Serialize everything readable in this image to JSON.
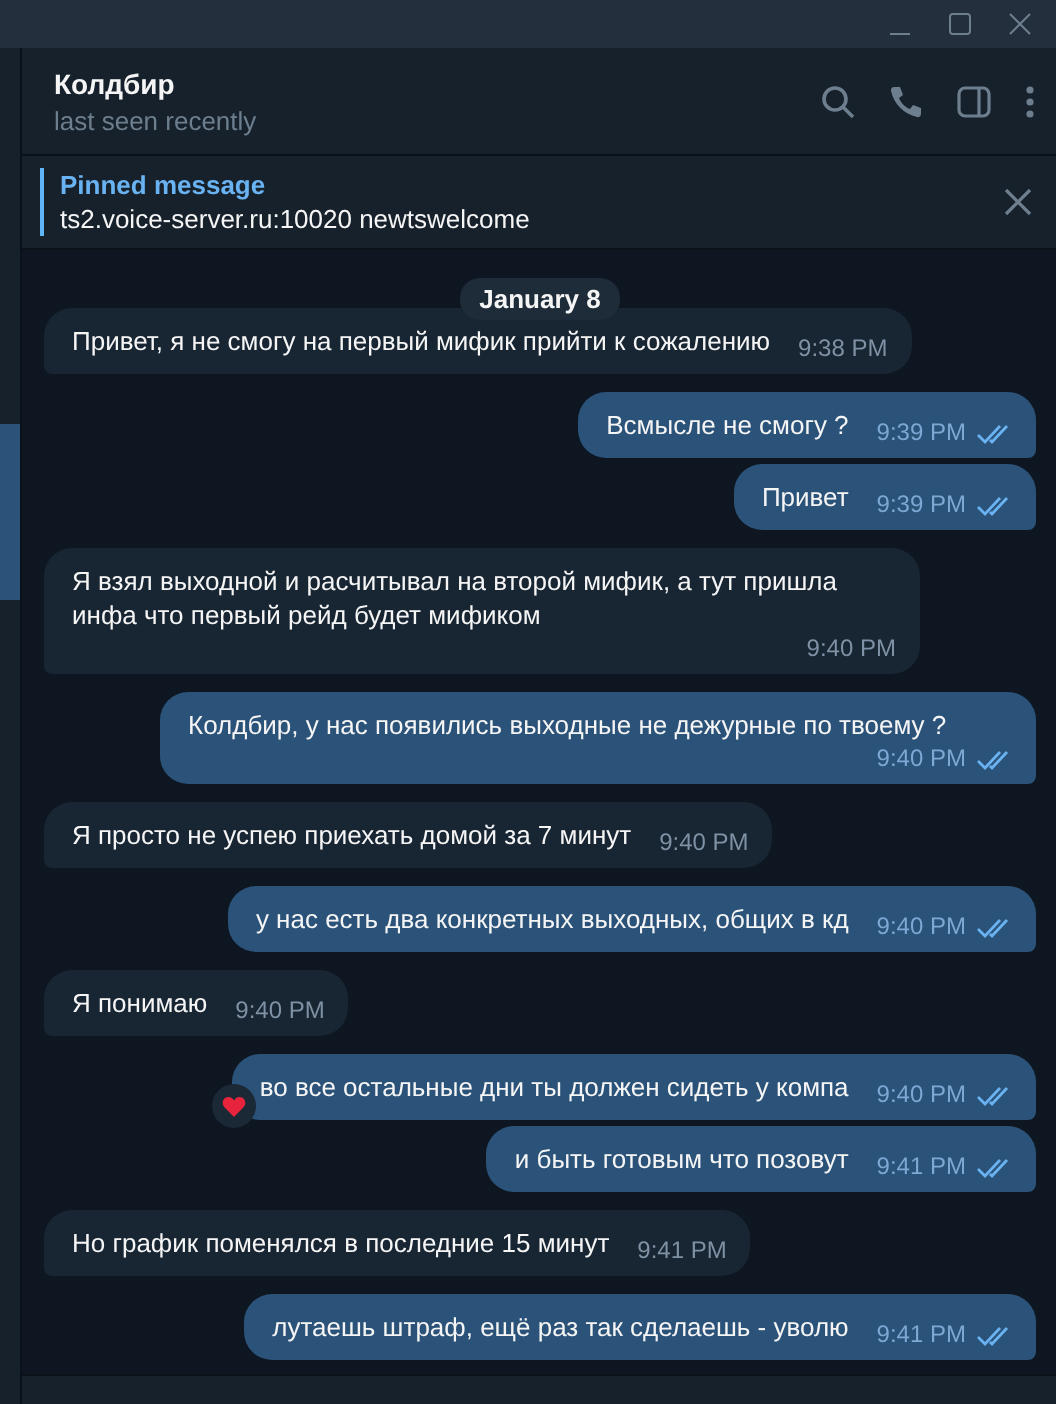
{
  "chat": {
    "name": "Колдбир",
    "status": "last seen recently"
  },
  "pinned": {
    "label": "Pinned message",
    "text": "ts2.voice-server.ru:10020 newtswelcome"
  },
  "date": "January 8",
  "messages": [
    {
      "kind": "incoming",
      "text": "Привет, я не смогу на первый мифик прийти к сожалению",
      "time": "9:38 PM"
    },
    {
      "kind": "outgoing",
      "text": "Всмысле не смогу ?",
      "time": "9:39 PM",
      "read": true
    },
    {
      "kind": "outgoing",
      "text": "Привет",
      "time": "9:39 PM",
      "read": true
    },
    {
      "kind": "incoming",
      "text": "Я взял выходной и расчитывал на второй мифик, а тут пришла инфа что первый рейд будет мификом",
      "time": "9:40 PM"
    },
    {
      "kind": "outgoing",
      "text": "Колдбир, у нас появились выходные не дежурные по твоему ?",
      "time": "9:40 PM",
      "read": true
    },
    {
      "kind": "incoming",
      "text": "Я просто не успею приехать домой за 7 минут",
      "time": "9:40 PM"
    },
    {
      "kind": "outgoing",
      "text": "у нас есть два конкретных выходных, общих в кд",
      "time": "9:40 PM",
      "read": true
    },
    {
      "kind": "incoming",
      "text": "Я понимаю",
      "time": "9:40 PM"
    },
    {
      "kind": "outgoing",
      "text": "во все остальные дни ты должен сидеть у компа",
      "time": "9:40 PM",
      "read": true,
      "reacted": true
    },
    {
      "kind": "outgoing",
      "text": "и быть готовым что позовут",
      "time": "9:41 PM",
      "read": true
    },
    {
      "kind": "incoming",
      "text": "Но график поменялся в последние 15 минут",
      "time": "9:41 PM"
    },
    {
      "kind": "outgoing",
      "text": "лутаешь штраф, ещё раз так сделаешь - уволю",
      "time": "9:41 PM",
      "read": true
    }
  ]
}
